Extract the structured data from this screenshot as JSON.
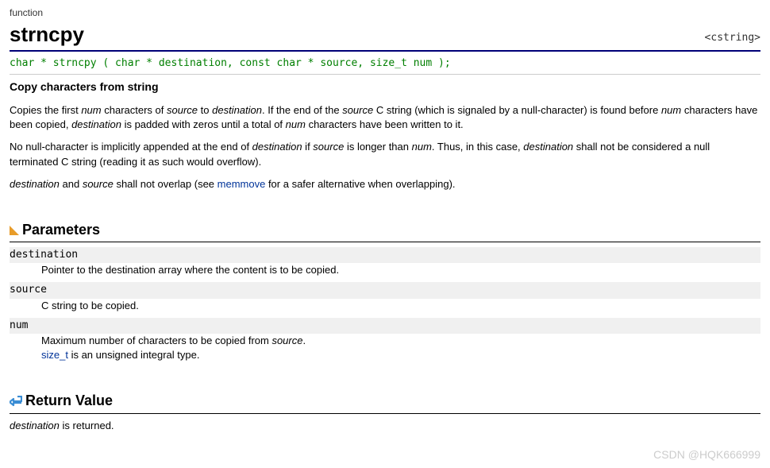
{
  "header": {
    "category": "function",
    "title": "strncpy",
    "include": "<cstring>"
  },
  "signature": "char * strncpy ( char * destination, const char * source, size_t num );",
  "brief": "Copy characters from string",
  "desc": {
    "p1_a": "Copies the first ",
    "p1_num": "num",
    "p1_b": " characters of ",
    "p1_source": "source",
    "p1_c": " to ",
    "p1_dest": "destination",
    "p1_d": ". If the end of the ",
    "p1_source2": "source",
    "p1_e": " C string (which is signaled by a null-character) is found before ",
    "p1_num2": "num",
    "p1_f": " characters have been copied, ",
    "p1_dest2": "destination",
    "p1_g": " is padded with zeros until a total of ",
    "p1_num3": "num",
    "p1_h": " characters have been written to it.",
    "p2_a": "No null-character is implicitly appended at the end of ",
    "p2_dest": "destination",
    "p2_b": " if ",
    "p2_source": "source",
    "p2_c": " is longer than ",
    "p2_num": "num",
    "p2_d": ". Thus, in this case, ",
    "p2_dest2": "destination",
    "p2_e": " shall not be considered a null terminated C string (reading it as such would overflow).",
    "p3_dest": "destination",
    "p3_a": " and ",
    "p3_src": "source",
    "p3_b": " shall not overlap (see ",
    "p3_link": "memmove",
    "p3_c": " for a safer alternative when overlapping)."
  },
  "sections": {
    "parameters": "Parameters",
    "return_value": "Return Value"
  },
  "params": {
    "dest_term": "destination",
    "dest_def": "Pointer to the destination array where the content is to be copied.",
    "src_term": "source",
    "src_def": "C string to be copied.",
    "num_term": "num",
    "num_def_a": "Maximum number of characters to be copied from ",
    "num_def_src": "source",
    "num_def_b": ".",
    "num_def2_link": "size_t",
    "num_def2_rest": " is an unsigned integral type."
  },
  "return": {
    "dest": "destination",
    "rest": " is returned."
  },
  "watermark": "CSDN @HQK666999"
}
